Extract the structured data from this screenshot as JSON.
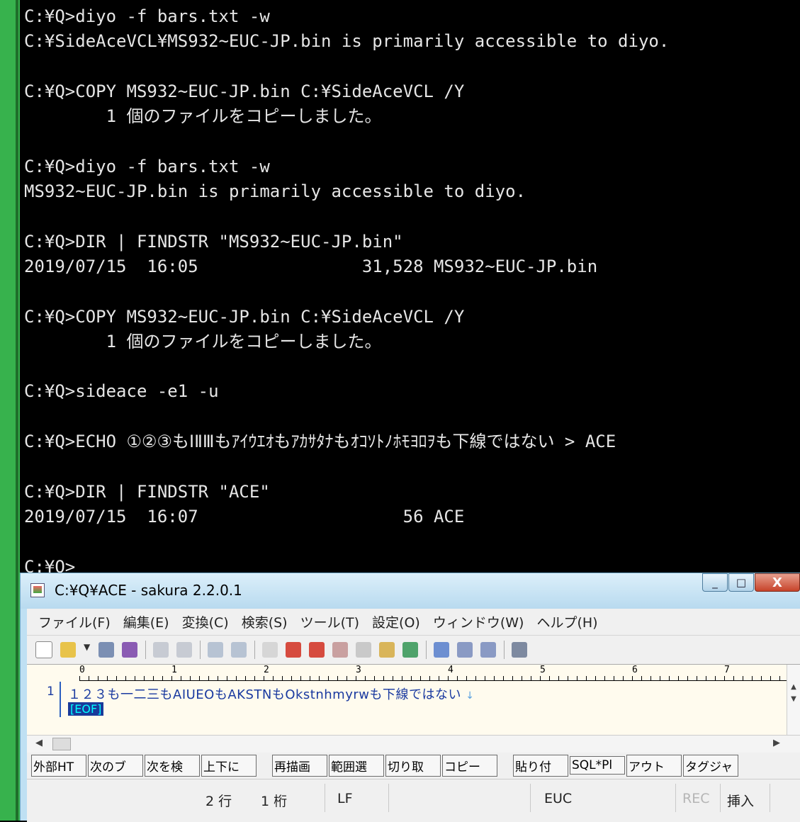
{
  "console": {
    "lines": [
      "C:¥Q>diyo -f bars.txt -w",
      "C:¥SideAceVCL¥MS932~EUC-JP.bin is primarily accessible to diyo.",
      "",
      "C:¥Q>COPY MS932~EUC-JP.bin C:¥SideAceVCL /Y",
      "        1 個のファイルをコピーしました。",
      "",
      "C:¥Q>diyo -f bars.txt -w",
      "MS932~EUC-JP.bin is primarily accessible to diyo.",
      "",
      "C:¥Q>DIR | FINDSTR \"MS932~EUC-JP.bin\"",
      "2019/07/15  16:05                31,528 MS932~EUC-JP.bin",
      "",
      "C:¥Q>COPY MS932~EUC-JP.bin C:¥SideAceVCL /Y",
      "        1 個のファイルをコピーしました。",
      "",
      "C:¥Q>sideace -e1 -u",
      "",
      "C:¥Q>ECHO ①②③もⅠⅡⅢもｱｲｳｴｵもｱｶｻﾀﾅもｵｺｿﾄﾉﾎﾓﾖﾛｦも下線ではない > ACE",
      "",
      "C:¥Q>DIR | FINDSTR \"ACE\"",
      "2019/07/15  16:07                    56 ACE",
      "",
      "C:¥Q>"
    ]
  },
  "editor": {
    "title": "C:¥Q¥ACE - sakura 2.2.0.1",
    "window_buttons": {
      "minimize": "_",
      "maximize": "□",
      "close": "X"
    },
    "menu": [
      "ファイル(F)",
      "編集(E)",
      "変換(C)",
      "検索(S)",
      "ツール(T)",
      "設定(O)",
      "ウィンドウ(W)",
      "ヘルプ(H)"
    ],
    "ruler": [
      "0",
      "1",
      "2",
      "3",
      "4",
      "5",
      "6",
      "7"
    ],
    "line_number": "1",
    "line_text": "１２３も一二三もAIUEOもAKSTNもOkstnhmyrwも下線ではない",
    "eol_mark": "↓",
    "eof_mark": "[EOF]",
    "function_keys": [
      "外部HT",
      "次のブ",
      "次を検",
      "上下に",
      "再描画",
      "範囲選",
      "切り取",
      "コピー",
      "貼り付",
      "SQL*Pl",
      "アウト",
      "タグジャ"
    ],
    "status": {
      "row": "2 行",
      "col": "1 桁",
      "eol": "LF",
      "encoding": "EUC",
      "rec": "REC",
      "mode": "挿入"
    }
  }
}
